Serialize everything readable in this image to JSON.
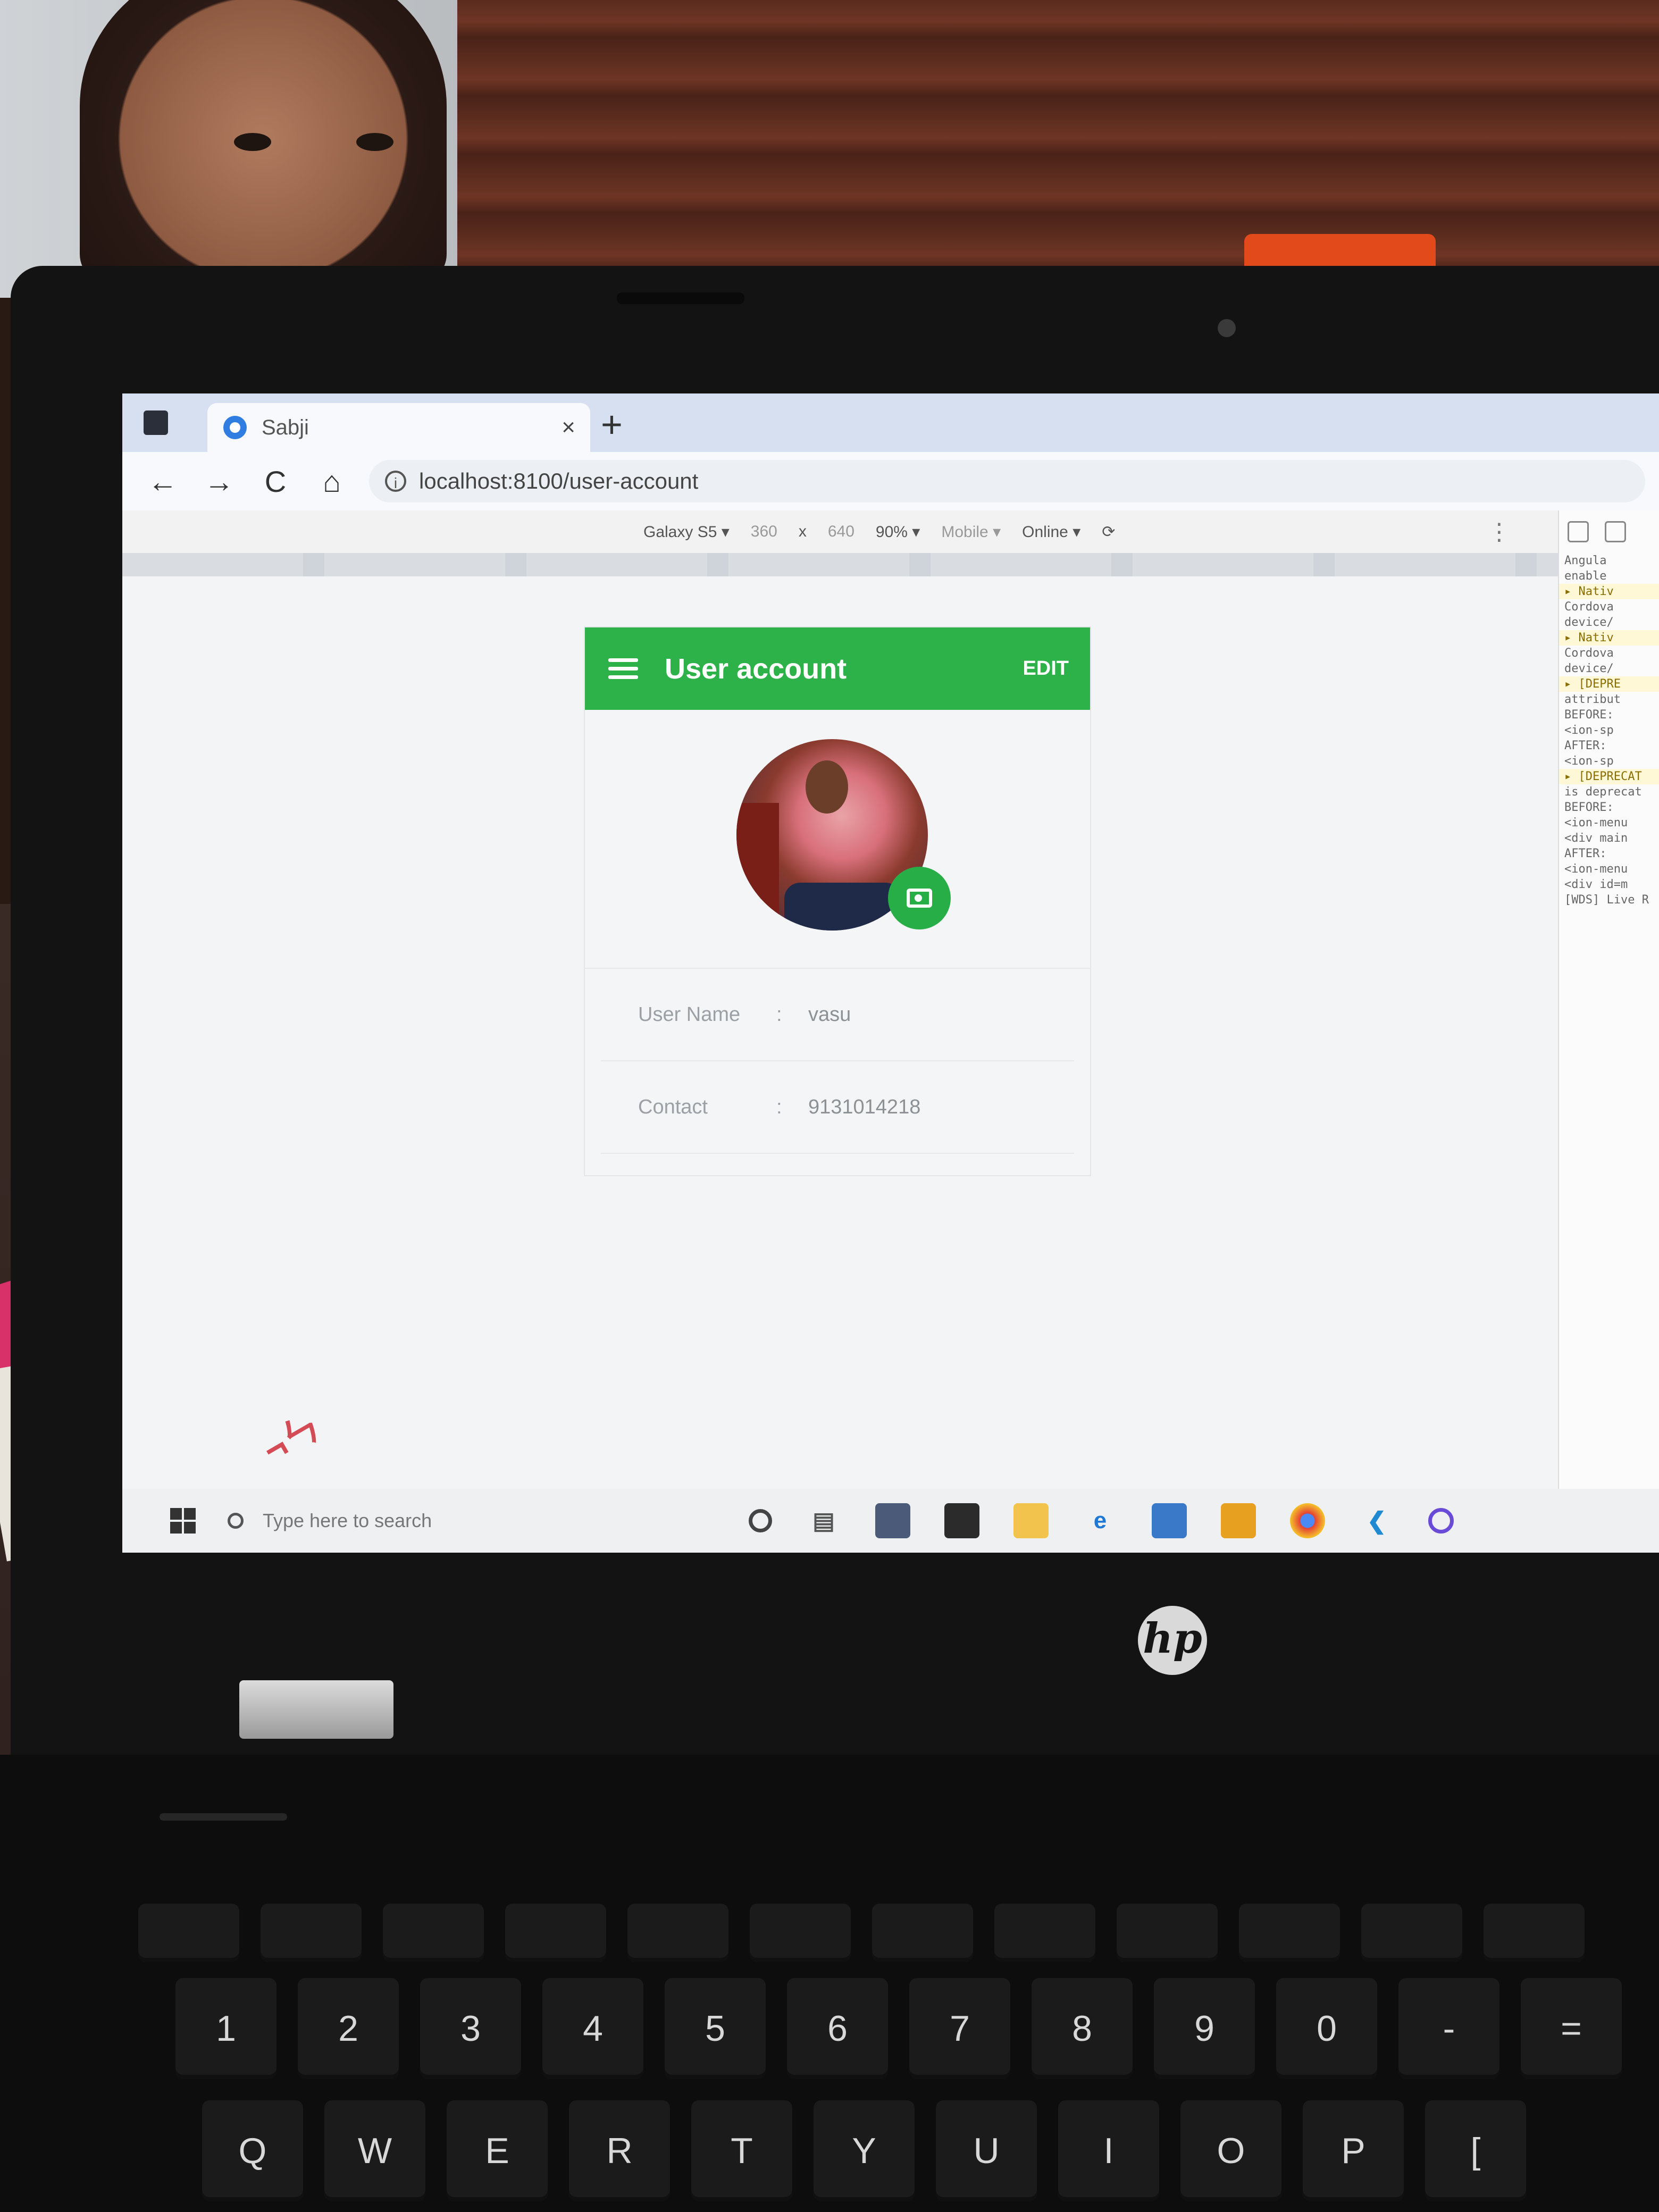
{
  "browser": {
    "tab_title": "Sabji",
    "tab_close": "×",
    "new_tab": "+",
    "url": "localhost:8100/user-account",
    "nav": {
      "back": "←",
      "forward": "→",
      "reload": "C",
      "home": "⌂"
    }
  },
  "device_toolbar": {
    "device": "Galaxy S5 ▾",
    "width": "360",
    "times": "x",
    "height": "640",
    "zoom": "90% ▾",
    "mode": "Mobile ▾",
    "network": "Online ▾"
  },
  "app": {
    "title": "User account",
    "edit_label": "EDIT",
    "accent_color": "#2db24a",
    "fields": [
      {
        "label": "User Name",
        "separator": ":",
        "value": "vasu"
      },
      {
        "label": "Contact",
        "separator": ":",
        "value": "9131014218"
      }
    ]
  },
  "console": {
    "lines": [
      "Angula",
      "enable",
      "▸ Nativ",
      "Cordova",
      "device/",
      "▸ Nativ",
      "Cordova",
      "device/",
      "▸ [DEPRE",
      "attribut",
      "BEFORE:",
      "<ion-sp",
      "AFTER:",
      "<ion-sp",
      "▸ [DEPRECAT",
      "is deprecat",
      "BEFORE:",
      "<ion-menu",
      "<div main",
      "AFTER:",
      "<ion-menu",
      "<div id=m",
      "[WDS] Live R"
    ]
  },
  "taskbar": {
    "search_placeholder": "Type here to search"
  },
  "laptop": {
    "brand": "hp",
    "keys_numbers": [
      "1",
      "2",
      "3",
      "4",
      "5",
      "6",
      "7",
      "8",
      "9",
      "0",
      "-",
      "="
    ],
    "keys_letters": [
      "Q",
      "W",
      "E",
      "R",
      "T",
      "Y",
      "U",
      "I",
      "O",
      "P",
      "["
    ]
  }
}
